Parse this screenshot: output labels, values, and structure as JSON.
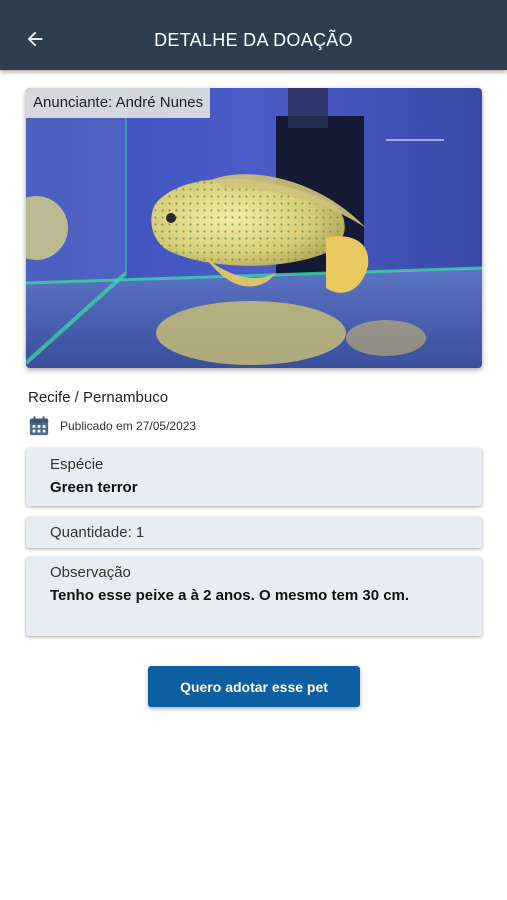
{
  "appbar": {
    "title": "DETALHE DA DOAÇÃO",
    "back_icon": "arrow-left-icon"
  },
  "photo": {
    "advertiser_label": "Anunciante: André Nunes",
    "subject": "aquarium-fish-photo"
  },
  "details": {
    "location": "Recife / Pernambuco",
    "published_icon": "calendar-icon",
    "published": "Publicado em 27/05/2023",
    "species_label": "Espécie",
    "species_value": "Green terror",
    "quantity": "Quantidade: 1",
    "observation_label": "Observação",
    "observation_value": "Tenho esse peixe a à 2 anos. O mesmo tem 30 cm."
  },
  "actions": {
    "adopt_label": "Quero adotar esse pet"
  },
  "colors": {
    "appbar": "#2f3e4e",
    "card": "#e8edf5",
    "primary_button": "#0d5ea3"
  }
}
